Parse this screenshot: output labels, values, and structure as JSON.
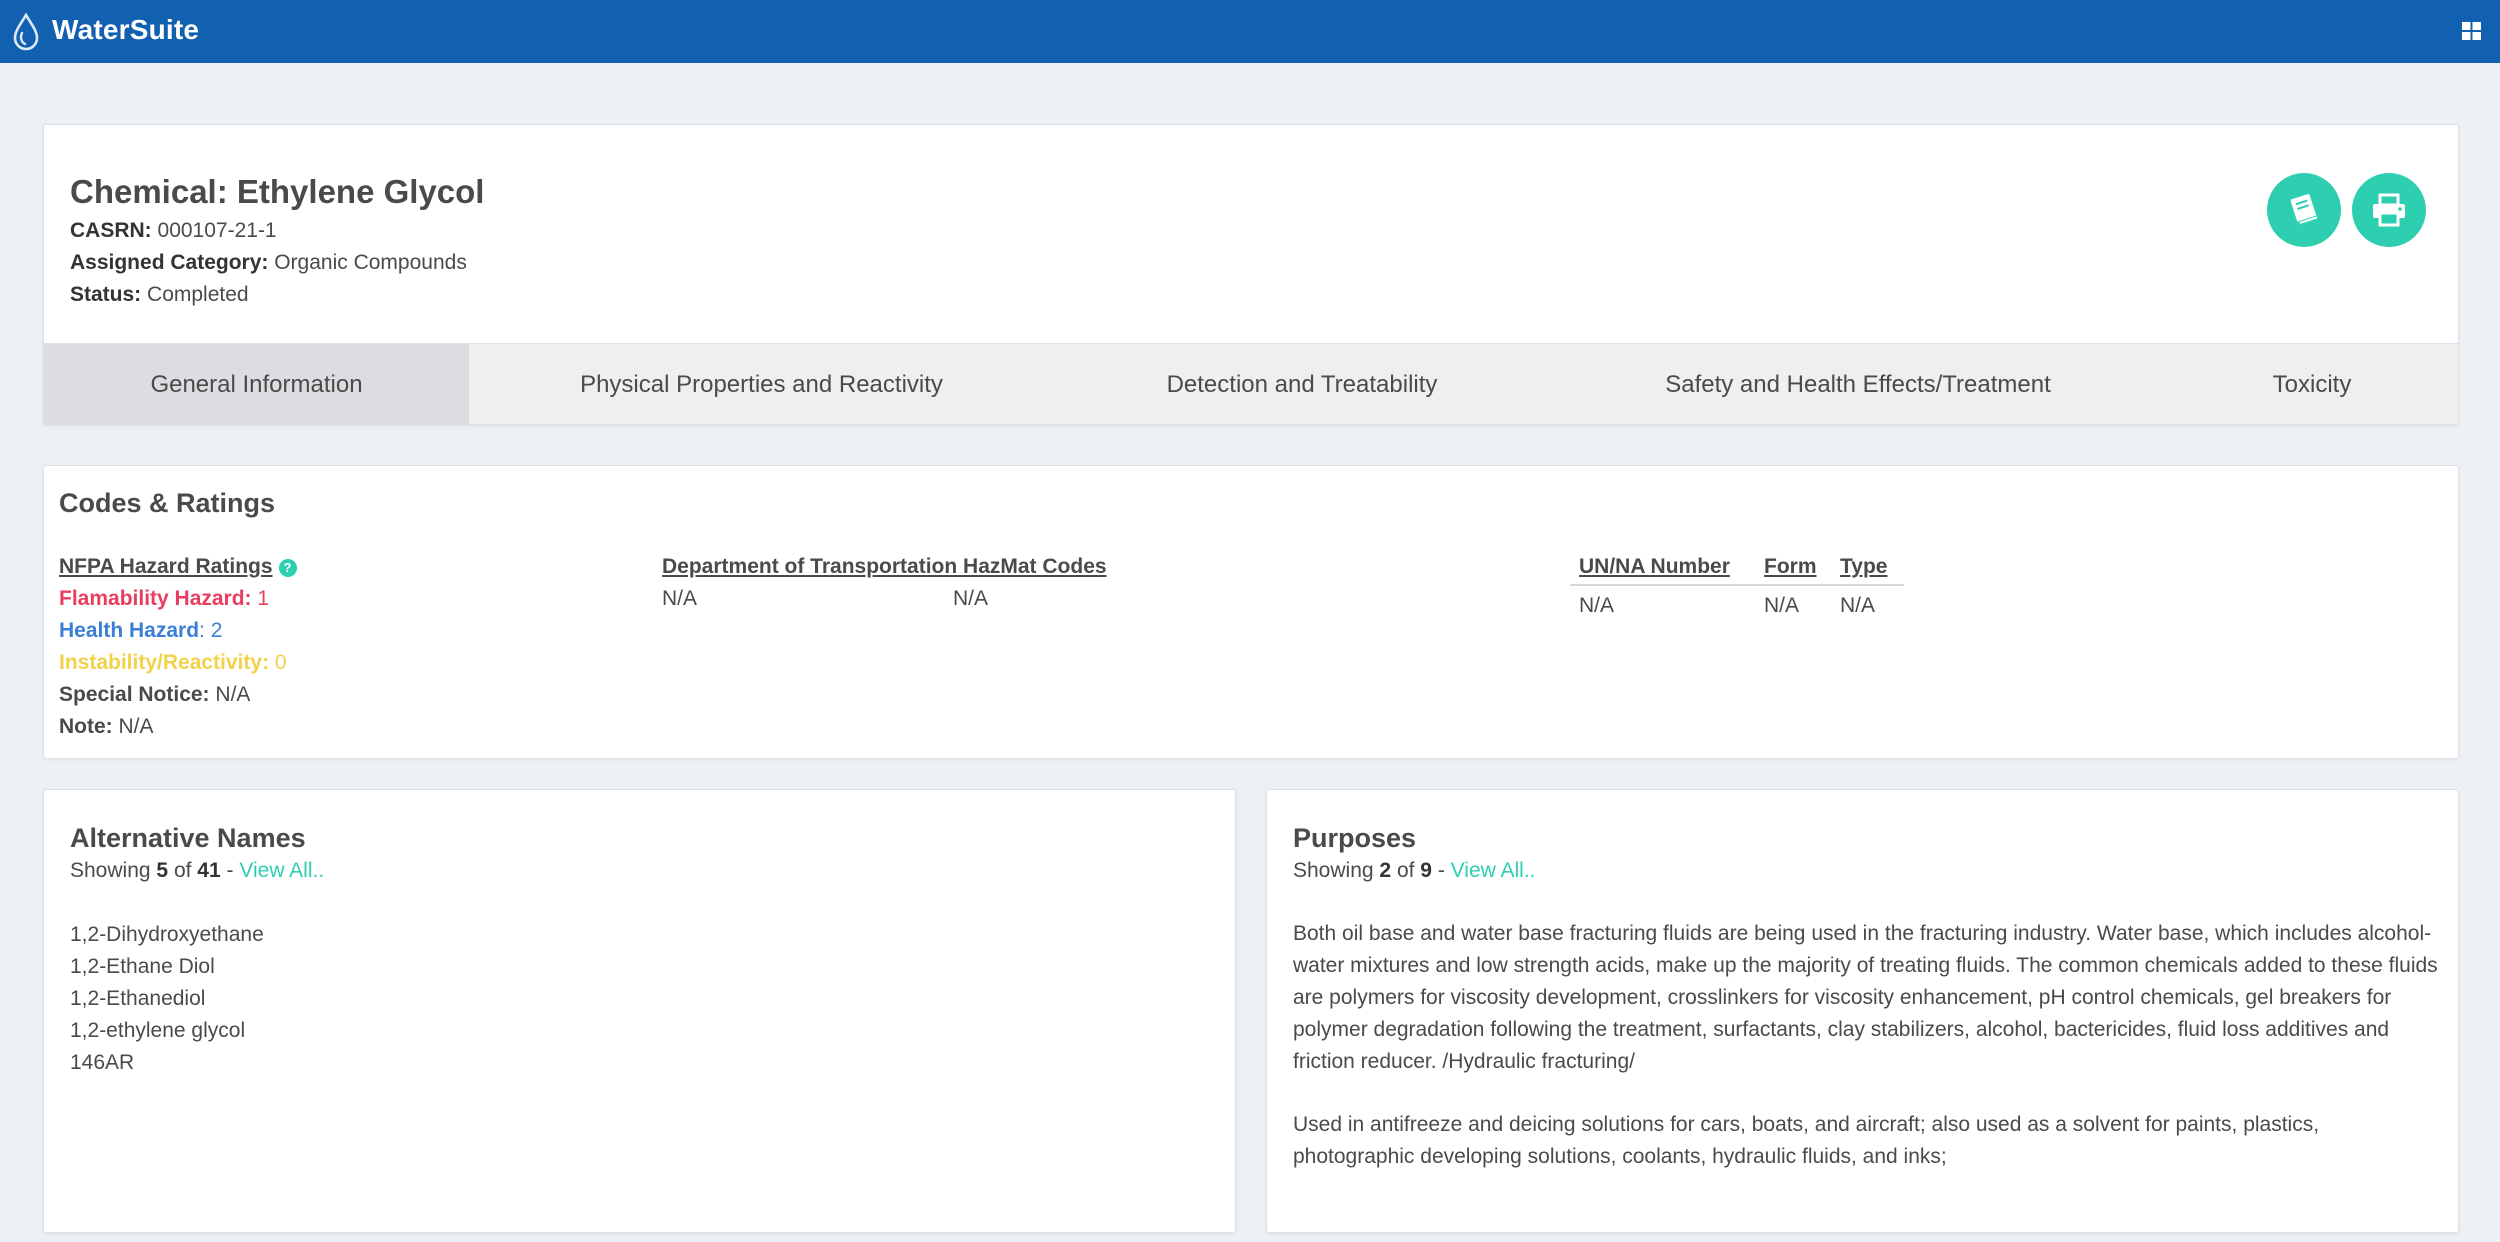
{
  "app": {
    "title": "WaterSuite"
  },
  "chemical": {
    "title": "Chemical: Ethylene Glycol",
    "casrn_label": "CASRN:",
    "casrn": "000107-21-1",
    "category_label": "Assigned Category:",
    "category": "Organic Compounds",
    "status_label": "Status:",
    "status": "Completed"
  },
  "tabs": [
    {
      "label": "General Information"
    },
    {
      "label": "Physical Properties and Reactivity"
    },
    {
      "label": "Detection and Treatability"
    },
    {
      "label": "Safety and Health Effects/Treatment"
    },
    {
      "label": "Toxicity"
    }
  ],
  "codes": {
    "title": "Codes & Ratings",
    "nfpa_heading": "NFPA Hazard Ratings",
    "flammability_label": "Flamability Hazard:",
    "flammability_value": "1",
    "health_label": "Health Hazard",
    "health_value": "2",
    "instability_label": "Instability/Reactivity:",
    "instability_value": "0",
    "special_label": "Special Notice:",
    "special_value": "N/A",
    "note_label": "Note:",
    "note_value": "N/A",
    "dot_heading": "Department of Transportation HazMat Codes",
    "dot_value_1": "N/A",
    "dot_value_2": "N/A",
    "un_headers": [
      "UN/NA Number",
      "Form",
      "Type"
    ],
    "un_values": [
      "N/A",
      "N/A",
      "N/A"
    ]
  },
  "alternative_names": {
    "title": "Alternative Names",
    "showing_prefix": "Showing",
    "shown": "5",
    "of": "of",
    "total": "41",
    "dash": "-",
    "view_all": "View All..",
    "items": [
      "1,2-Dihydroxyethane",
      "1,2-Ethane Diol",
      "1,2-Ethanediol",
      "1,2-ethylene glycol",
      "146AR"
    ]
  },
  "purposes": {
    "title": "Purposes",
    "showing_prefix": "Showing",
    "shown": "2",
    "of": "of",
    "total": "9",
    "dash": "-",
    "view_all": "View All..",
    "items": [
      "Both oil base and water base fracturing fluids are being used in the fracturing industry. Water base, which includes alcohol-water mixtures and low strength acids, make up the majority of treating fluids. The common chemicals added to these fluids are polymers for viscosity development, crosslinkers for viscosity enhancement, pH control chemicals, gel breakers for polymer degradation following the treatment, surfactants, clay stabilizers, alcohol, bactericides, fluid loss additives and friction reducer. /Hydraulic fracturing/",
      "Used in antifreeze and deicing solutions for cars, boats, and aircraft; also used as a solvent for paints, plastics, photographic developing solutions, coolants, hydraulic fluids, and inks;"
    ]
  },
  "colors": {
    "topbar": "#1260b0",
    "accent": "#2ecfb0",
    "flammability": "#e83d5f",
    "health": "#3a7fd5",
    "instability": "#f2d24a"
  }
}
